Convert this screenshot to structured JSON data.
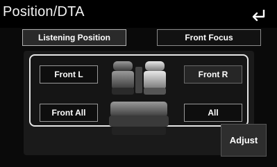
{
  "window": {
    "title": "Position/DTA"
  },
  "tabs": [
    {
      "label": "Listening Position",
      "active": true
    },
    {
      "label": "Front Focus",
      "active": false
    }
  ],
  "positions": {
    "front_l": "Front L",
    "front_r": "Front R",
    "front_all": "Front All",
    "all": "All"
  },
  "adjust_label": "Adjust",
  "icons": {
    "back": "back-arrow-icon",
    "seats": "car-seats-icon"
  }
}
